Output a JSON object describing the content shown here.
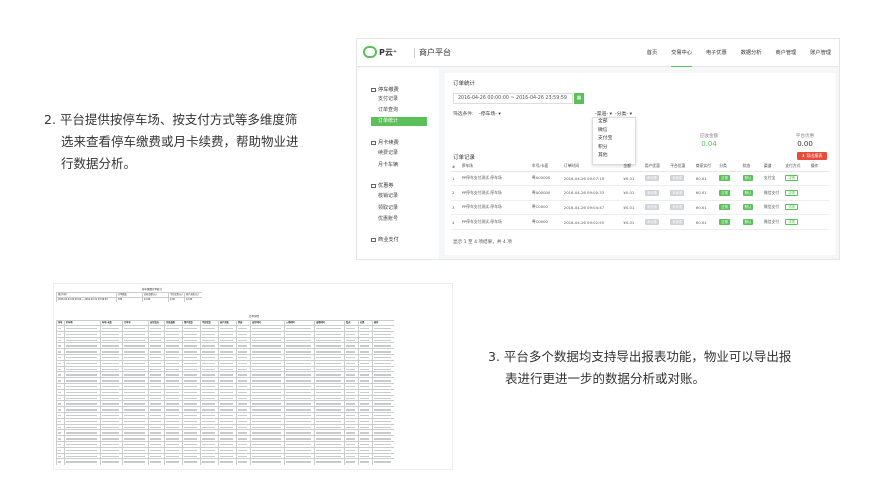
{
  "desc2": {
    "lines": [
      "2. 平台提供按停车场、按支付方式等多维度筛",
      "选来查看停车缴费或月卡续费，帮助物业进",
      "行数据分析。"
    ]
  },
  "desc3": {
    "lines": [
      "3. 平台多个数据均支持导出报表功能，物业可以导出报",
      "表进行更进一步的数据分析或对账。"
    ]
  },
  "app": {
    "logo_text": "P云⁺",
    "logo_sub": "商户平台",
    "nav": [
      "首页",
      "交易中心",
      "电子优惠",
      "数据分析",
      "商户管理",
      "账户管理"
    ],
    "nav_active_index": 1,
    "accent_color": "#5cc05a",
    "sidebar": {
      "groups": [
        {
          "label": "停车缴费",
          "icon": "car-icon",
          "items": [
            "支付记录",
            "订单查询",
            "订单统计"
          ]
        },
        {
          "label": "月卡续费",
          "icon": "card-icon",
          "items": [
            "续费记录",
            "月卡车辆"
          ]
        },
        {
          "label": "优惠券",
          "icon": "coupon-icon",
          "items": [
            "核销记录",
            "领取记录",
            "优惠账号"
          ]
        },
        {
          "label": "商业支付",
          "icon": "shop-icon",
          "items": []
        }
      ],
      "active_item": "订单统计"
    },
    "panel": {
      "title": "订单统计",
      "date_range": "2016-04-26 00:00:00 ~ 2016-04-26 23:59:59",
      "filter_label": "筛选条件:",
      "filters": [
        "-停车场-",
        "-渠道-",
        "-分类-"
      ],
      "dropdown_options": [
        "全部",
        "微信",
        "支付宝",
        "积分",
        "其他"
      ],
      "stats": [
        {
          "label": "",
          "value": ""
        },
        {
          "label": "应收金额",
          "value": "0.04"
        },
        {
          "label": "平台优惠",
          "value": "0.00"
        }
      ],
      "records_title": "订单记录",
      "export_label": "导出报表",
      "columns": [
        "#",
        "停车场",
        "车号/卡面",
        "订单时间",
        "金额",
        "用户优惠",
        "平台优惠",
        "商家实付",
        "分类",
        "状态",
        "渠道",
        "支付方式",
        "操作"
      ],
      "rows": [
        [
          "1",
          "PP停车支付测试-停车场",
          "粤A00000",
          "2016-04-26 09:07:19",
          "¥0.01",
          "未优惠",
          "未优惠",
          "¥0.01",
          "正常",
          "默认",
          "支付宝",
          "详情"
        ],
        [
          "2",
          "PP停车支付测试-停车场",
          "粤A00000",
          "2016-04-26 09:00:33",
          "¥0.01",
          "未优惠",
          "未优惠",
          "¥0.01",
          "正常",
          "默认",
          "微信支付",
          "详情"
        ],
        [
          "3",
          "PP停车支付测试-停车场",
          "粤C0000",
          "2016-04-26 09:04:47",
          "¥0.01",
          "未优惠",
          "未优惠",
          "¥0.01",
          "正常",
          "默认",
          "微信支付",
          "详情"
        ],
        [
          "4",
          "PP停车支付测试-停车场",
          "粤C0000",
          "2016-04-26 09:02:55",
          "¥0.01",
          "未优惠",
          "未优惠",
          "¥0.01",
          "正常",
          "默认",
          "微信支付",
          "详情"
        ]
      ],
      "pagination": "显示 1 至 4 项结果，共 4 项"
    }
  },
  "sheet": {
    "title": "停车缴费订单统计",
    "subtitle": "订单详情",
    "summary_headers": [
      "统计时间",
      "订单数量",
      "应收金额(元)",
      "平台优惠(元)",
      "商户实收(元)"
    ],
    "summary_values": [
      "2016-03-01 00:00:00 ~ 2016-03-31 23:59:59",
      "180",
      "12.60",
      "0.00",
      "12.60"
    ],
    "columns": [
      "序号",
      "停车场",
      "车号/卡面",
      "订单号",
      "支付渠道",
      "付款金额",
      "用户优惠",
      "平台优惠",
      "商户实收",
      "状态",
      "支付时间",
      "入场时间",
      "出场时间",
      "渠道",
      "分类",
      "操作"
    ],
    "row_count": 24
  }
}
